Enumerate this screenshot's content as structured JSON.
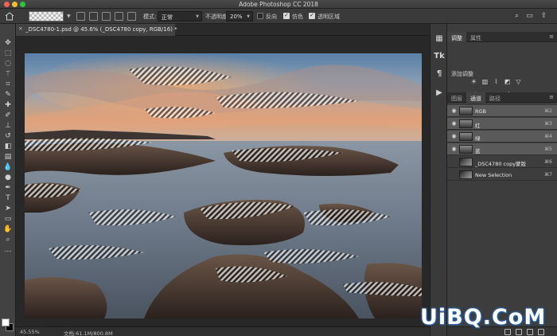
{
  "window": {
    "title": "Adobe Photoshop CC 2018"
  },
  "options_bar": {
    "mode_label": "模式:",
    "mode_value": "正常",
    "opacity_label": "不透明度:",
    "opacity_value": "20%",
    "reverse_label": "反向",
    "dither_label": "仿色",
    "transparency_label": "透明区域",
    "reverse_checked": false,
    "dither_checked": true,
    "transparency_checked": true
  },
  "document": {
    "tab_title": "_DSC4780-1.psd @ 45.6% (_DSC4780 copy, RGB/16) *"
  },
  "status": {
    "zoom": "45.55%",
    "doc_size": "文档:61.1M/800.8M"
  },
  "panels": {
    "top_tabs": [
      "调整",
      "属性"
    ],
    "adjustments_title": "添加调整",
    "mid_tabs": [
      "图层",
      "通道",
      "路径"
    ],
    "channels": [
      {
        "name": "RGB",
        "shortcut": "⌘2",
        "visible": true,
        "selected": true
      },
      {
        "name": "红",
        "shortcut": "⌘3",
        "visible": true,
        "selected": true
      },
      {
        "name": "绿",
        "shortcut": "⌘4",
        "visible": true,
        "selected": true
      },
      {
        "name": "蓝",
        "shortcut": "⌘5",
        "visible": true,
        "selected": true
      },
      {
        "name": "_DSC4780 copy蒙版",
        "shortcut": "⌘6",
        "visible": false,
        "selected": false
      },
      {
        "name": "New Selection",
        "shortcut": "⌘7",
        "visible": false,
        "selected": false
      }
    ]
  },
  "watermark": "UiBQ.CoM",
  "colors": {
    "accent_selected_row": "#5a5a5a",
    "panel_bg": "#3d3d3d",
    "watermark_glow": "#2a70c8"
  }
}
